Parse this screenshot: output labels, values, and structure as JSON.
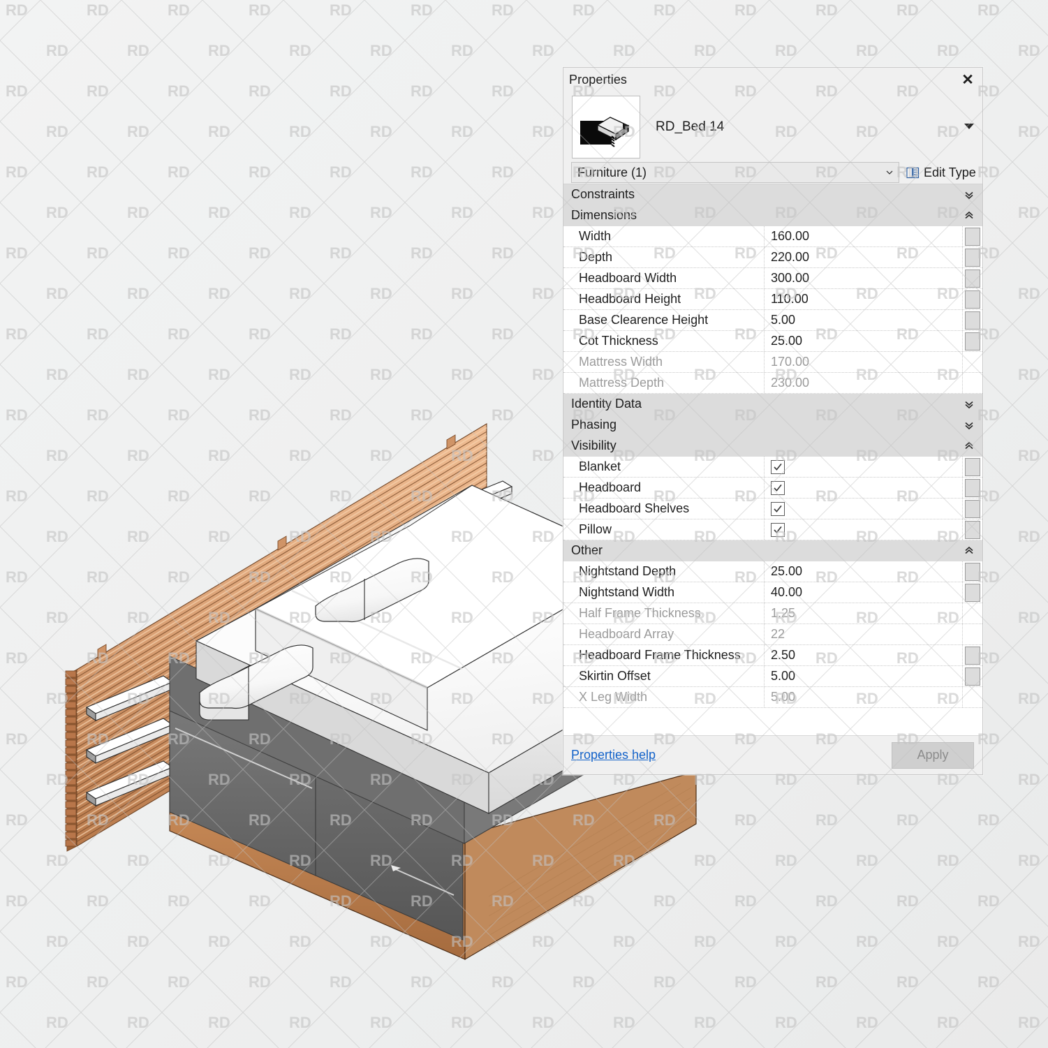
{
  "watermark": {
    "text": "RD"
  },
  "viewport": {
    "name": "revit-3d-view",
    "model_label": "RD_Bed 14 isometric model"
  },
  "panel": {
    "title": "Properties",
    "close_label": "✕",
    "type_name": "RD_Bed 14",
    "category": "Furniture (1)",
    "edit_type_label": "Edit Type",
    "sections": [
      {
        "name": "Constraints",
        "state": "collapsed",
        "rows": []
      },
      {
        "name": "Dimensions",
        "state": "expanded",
        "rows": [
          {
            "label": "Width",
            "value": "160.00",
            "type": "text",
            "readonly": false
          },
          {
            "label": "Depth",
            "value": "220.00",
            "type": "text",
            "readonly": false
          },
          {
            "label": "Headboard Width",
            "value": "300.00",
            "type": "text",
            "readonly": false
          },
          {
            "label": "Headboard Height",
            "value": "110.00",
            "type": "text",
            "readonly": false
          },
          {
            "label": "Base Clearence Height",
            "value": "5.00",
            "type": "text",
            "readonly": false
          },
          {
            "label": "Cot Thickness",
            "value": "25.00",
            "type": "text",
            "readonly": false
          },
          {
            "label": "Mattress Width",
            "value": "170.00",
            "type": "text",
            "readonly": true
          },
          {
            "label": "Mattress Depth",
            "value": "230.00",
            "type": "text",
            "readonly": true
          }
        ]
      },
      {
        "name": "Identity Data",
        "state": "collapsed",
        "rows": []
      },
      {
        "name": "Phasing",
        "state": "collapsed",
        "rows": []
      },
      {
        "name": "Visibility",
        "state": "expanded",
        "rows": [
          {
            "label": "Blanket",
            "value": "checked",
            "type": "checkbox",
            "readonly": false
          },
          {
            "label": "Headboard",
            "value": "checked",
            "type": "checkbox",
            "readonly": false
          },
          {
            "label": "Headboard Shelves",
            "value": "checked",
            "type": "checkbox",
            "readonly": false
          },
          {
            "label": "Pillow",
            "value": "checked",
            "type": "checkbox",
            "readonly": false
          }
        ]
      },
      {
        "name": "Other",
        "state": "expanded",
        "rows": [
          {
            "label": "Nightstand Depth",
            "value": "25.00",
            "type": "text",
            "readonly": false
          },
          {
            "label": "Nightstand Width",
            "value": "40.00",
            "type": "text",
            "readonly": false
          },
          {
            "label": "Half Frame Thickness",
            "value": "1.25",
            "type": "text",
            "readonly": true
          },
          {
            "label": "Headboard Array",
            "value": "22",
            "type": "text",
            "readonly": true
          },
          {
            "label": "Headboard Frame Thickness",
            "value": "2.50",
            "type": "text",
            "readonly": false
          },
          {
            "label": "Skirtin Offset",
            "value": "5.00",
            "type": "text",
            "readonly": false
          },
          {
            "label": "X Leg Width",
            "value": "5.00",
            "type": "text",
            "readonly": true
          }
        ]
      }
    ],
    "footer": {
      "help_label": "Properties help",
      "apply_label": "Apply"
    }
  },
  "colors": {
    "background": "#eff0f0",
    "panel_bg": "#f0f0f0",
    "section_header": "#dcdcdc",
    "link": "#1161c9",
    "wood_light": "#e0a878",
    "wood_mid": "#c98a57",
    "wood_dark": "#8a5a33",
    "mattress": "#ffffff",
    "base_gray": "#6d6d6d"
  }
}
